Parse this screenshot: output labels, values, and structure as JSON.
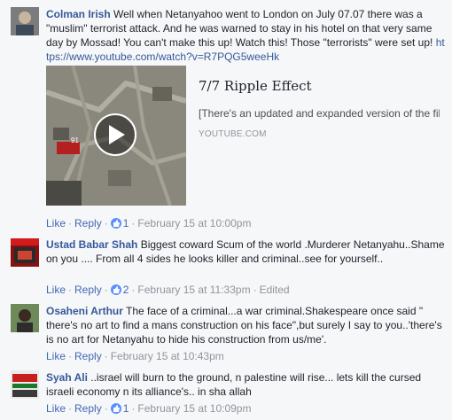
{
  "actions": {
    "like": "Like",
    "reply": "Reply",
    "dot": "·"
  },
  "comments": [
    {
      "author": "Colman Irish",
      "text": " Well when Netanyahoo went to London on July 07.07 there was a \"muslim\" terrorist attack. And he was warned to stay in his hotel on that very same day by Mossad! You can't make this up! Watch this! Those \"terrorists\" were set up! ",
      "link": "https://www.youtube.com/watch?v=R7PQG5weeHk",
      "likes": "1",
      "time": "February 15 at 10:00pm",
      "preview": {
        "title": "7/7 Ripple Effect",
        "description": "[There's an updated and expanded version of the film available here: https://www.youtube....",
        "source": "YOUTUBE.COM",
        "thumb_label": "91"
      }
    },
    {
      "author": "Ustad Babar Shah",
      "text": " Biggest coward Scum of the world .Murderer Netanyahu..Shame on you .... From all 4 sides he looks killer and criminal..see for yourself..",
      "likes": "2",
      "time": "February 15 at 11:33pm",
      "edited": "Edited"
    },
    {
      "author": "Osaheni Arthur",
      "text": " The face of a criminal...a war criminal.Shakespeare once said \" there's no art to find a mans construction on his face\",but surely I say to you..'there's is no art for Netanyahu to hide his construction from us/me'.",
      "time": "February 15 at 10:43pm"
    },
    {
      "author": "Syah Ali",
      "text": " ..israel will burn to the ground, n palestine will rise... lets kill the cursed israeli economy n its alliance's.. in sha allah",
      "likes": "1",
      "time": "February 15 at 10:09pm"
    }
  ]
}
